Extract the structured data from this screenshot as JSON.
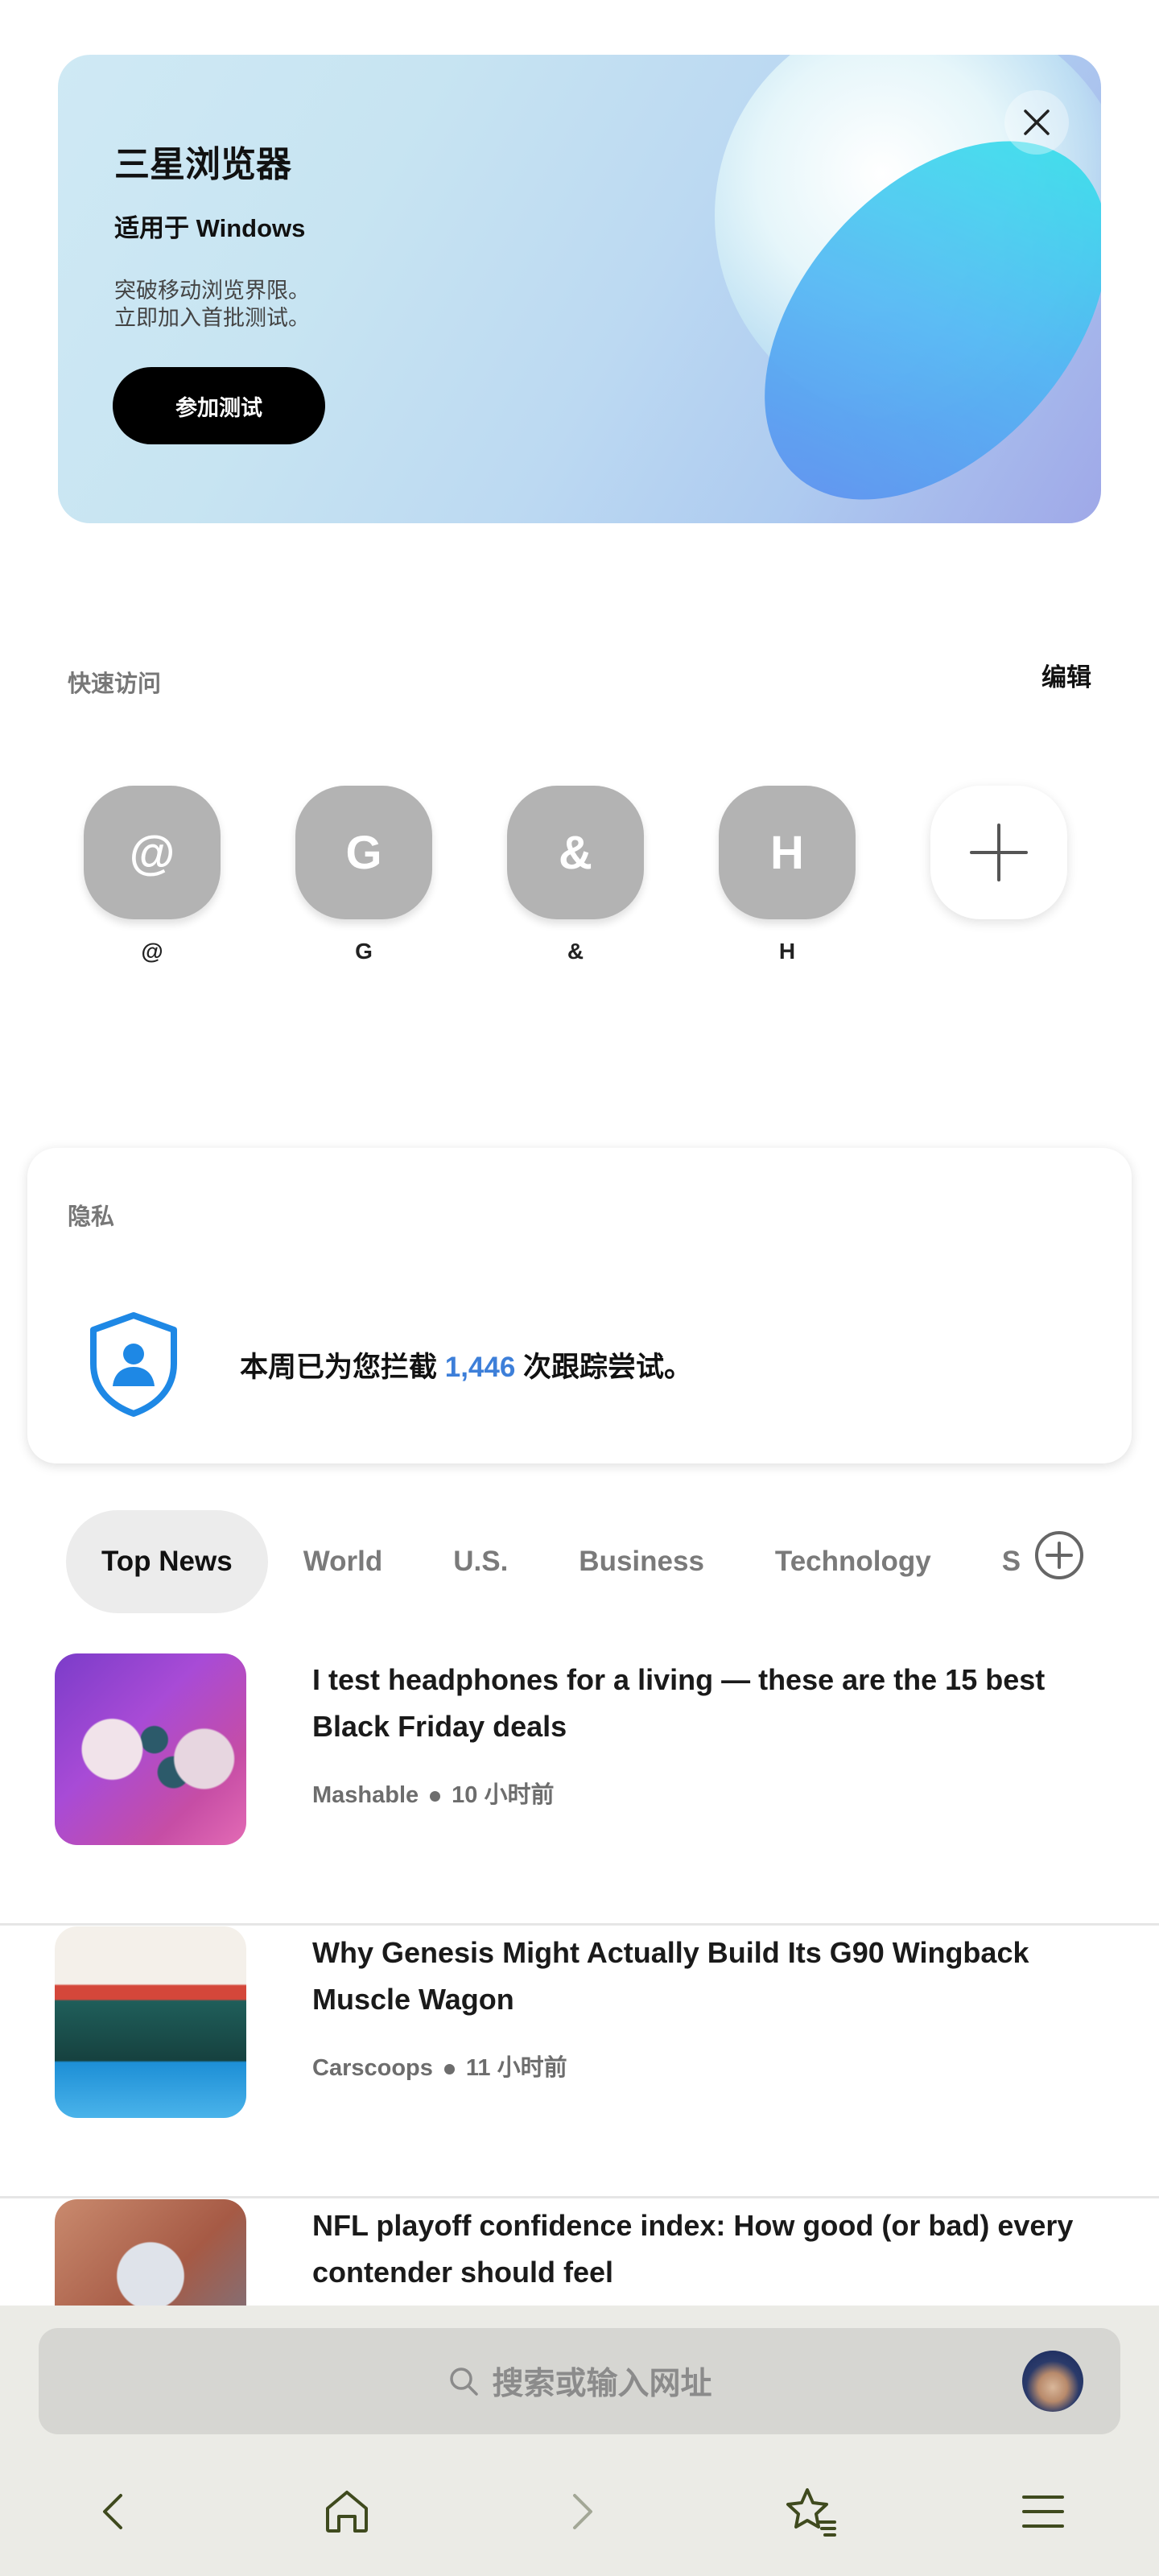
{
  "promo": {
    "title": "三星浏览器",
    "subtitle": "适用于 Windows",
    "desc_line1": "突破移动浏览界限。",
    "desc_line2": "立即加入首批测试。",
    "button": "参加测试"
  },
  "quick_access": {
    "label": "快速访问",
    "edit": "编辑",
    "items": [
      {
        "icon": "@",
        "name": "@"
      },
      {
        "icon": "G",
        "name": "G"
      },
      {
        "icon": "&",
        "name": "&"
      },
      {
        "icon": "H",
        "name": "H"
      }
    ]
  },
  "privacy": {
    "title": "隐私",
    "text_before": "本周已为您拦截 ",
    "count": "1,446",
    "text_after": " 次跟踪尝试。"
  },
  "tabs": [
    "Top News",
    "World",
    "U.S.",
    "Business",
    "Technology",
    "S"
  ],
  "news": [
    {
      "headline": "I test headphones for a living — these are the 15 best Black Friday deals",
      "source": "Mashable",
      "time": "10 小时前"
    },
    {
      "headline": "Why Genesis Might Actually Build Its G90 Wingback Muscle Wagon",
      "source": "Carscoops",
      "time": "11 小时前"
    },
    {
      "headline": "NFL playoff confidence index: How good (or bad) every contender should feel",
      "source": "",
      "time": ""
    }
  ],
  "search": {
    "placeholder": "搜索或输入网址"
  },
  "colors": {
    "accent": "#3d7fd9",
    "promo_button": "#000000"
  }
}
